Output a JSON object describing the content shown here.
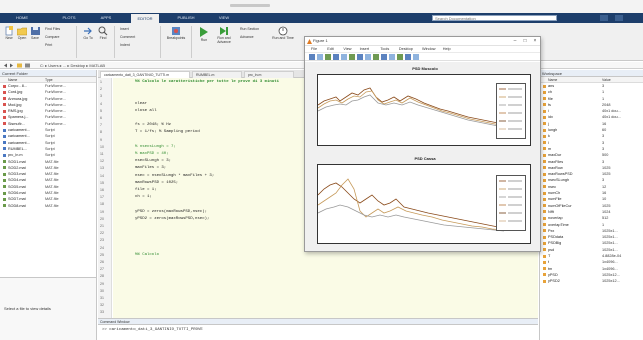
{
  "app": {
    "ribbon_tabs": [
      "HOME",
      "PLOTS",
      "APPS",
      "EDITOR",
      "PUBLISH",
      "VIEW"
    ],
    "active_tab": "EDITOR",
    "search_placeholder": "Search Documentation"
  },
  "ribbon": {
    "new_label": "New",
    "open_label": "Open",
    "save_label": "Save",
    "find_files": "Find Files",
    "compare": "Compare",
    "print": "Print",
    "go_to": "Go To",
    "find": "Find",
    "insert": "Insert",
    "comment": "Comment",
    "indent": "Indent",
    "breakpoints": "Breakpoints",
    "run": "Run",
    "run_and_advance": "Run and Advance",
    "run_section": "Run Section",
    "advance": "Advance",
    "run_and_time": "Run and Time"
  },
  "current_folder": {
    "title": "Current Folder",
    "col_name": "Name",
    "col_type": "Type",
    "files": [
      {
        "name": "Corpo - 8...",
        "type": "FunWorne...",
        "color": "#d9534f"
      },
      {
        "name": "Cord.jpg",
        "type": "FunWorne...",
        "color": "#d9534f"
      },
      {
        "name": "Anmura.jpg",
        "type": "FunWorne...",
        "color": "#d9534f"
      },
      {
        "name": "Mod.jpg",
        "type": "FunWorne...",
        "color": "#d9534f"
      },
      {
        "name": "RMS.jpg",
        "type": "FunWorne...",
        "color": "#d9534f"
      },
      {
        "name": "Spamera.j...",
        "type": "FunWorne...",
        "color": "#d9534f"
      },
      {
        "name": "Sismufir...",
        "type": "FunWorne...",
        "color": "#d9534f"
      },
      {
        "name": "caricament...",
        "type": "Script",
        "color": "#4a78c2"
      },
      {
        "name": "caricament...",
        "type": "Script",
        "color": "#4a78c2"
      },
      {
        "name": "caricament...",
        "type": "Script",
        "color": "#4a78c2"
      },
      {
        "name": "RUMBEL...",
        "type": "Script",
        "color": "#4a78c2"
      },
      {
        "name": "prc_ln.m",
        "type": "Script",
        "color": "#4a78c2"
      },
      {
        "name": "SOD1.mat",
        "type": "MAT-file",
        "color": "#6a9a4a"
      },
      {
        "name": "SOD2.mat",
        "type": "MAT-file",
        "color": "#6a9a4a"
      },
      {
        "name": "SOD3.mat",
        "type": "MAT-file",
        "color": "#6a9a4a"
      },
      {
        "name": "SOD4.mat",
        "type": "MAT-file",
        "color": "#6a9a4a"
      },
      {
        "name": "SOD5.mat",
        "type": "MAT-file",
        "color": "#6a9a4a"
      },
      {
        "name": "SOD6.mat",
        "type": "MAT-file",
        "color": "#6a9a4a"
      },
      {
        "name": "SOD7.mat",
        "type": "MAT-file",
        "color": "#6a9a4a"
      },
      {
        "name": "SOD8.mat",
        "type": "MAT-file",
        "color": "#6a9a4a"
      }
    ],
    "details_text": "Select a file to view details"
  },
  "editor": {
    "tabs": [
      "caricamento_dati_3_GANTINIO_TUTTI.m",
      "RUMBEL.m",
      "prc_ln.m"
    ],
    "line_numbers": [
      "1",
      "2",
      "3",
      "4",
      "5",
      "6",
      "7",
      "8",
      "9",
      "10",
      "11",
      "12",
      "13",
      "14",
      "15",
      "16",
      "17",
      "18",
      "19",
      "20",
      "21",
      "22",
      "23",
      "24",
      "25",
      "26",
      "27",
      "28",
      "29",
      "30",
      "31",
      "32",
      "33"
    ],
    "cell_title": "%% Calcolo le caratteristiche per tutte le prove di 3 minuti",
    "code_lines": [
      {
        "t": "clear",
        "cls": "code",
        "row": 3
      },
      {
        "t": "close all",
        "cls": "code",
        "row": 4
      },
      {
        "t": "fs = 2048;     % Hz",
        "cls": "code",
        "row": 6
      },
      {
        "t": "T = 1/fs;      % Sampling period",
        "cls": "code",
        "row": 7
      },
      {
        "t": "% nsecsLungh = 7;",
        "cls": "cmt",
        "row": 9
      },
      {
        "t": "% maxPSD = 40;",
        "cls": "cmt",
        "row": 10
      },
      {
        "t": "nsecSLungh = 3;",
        "cls": "code",
        "row": 11
      },
      {
        "t": "maxFiles = 3;",
        "cls": "code",
        "row": 12
      },
      {
        "t": "nsec = nsecSLungh * maxFiles + 3;",
        "cls": "code",
        "row": 13
      },
      {
        "t": "maxRowsPSD = 1025;",
        "cls": "code",
        "row": 14
      },
      {
        "t": "file = 1;",
        "cls": "code",
        "row": 15
      },
      {
        "t": "ch = 1;",
        "cls": "code",
        "row": 16
      },
      {
        "t": "yPSD = zeros(maxRowsPSD,nsec);",
        "cls": "code",
        "row": 18
      },
      {
        "t": "yPSD2 = zeros(maxRowsPSD,nsec);",
        "cls": "code",
        "row": 19
      },
      {
        "t": "%% Calcolo",
        "cls": "cmt",
        "row": 24
      }
    ]
  },
  "command_window": {
    "title": "Command Window",
    "prompt": ">> caricamento_dati_3_GANTINIO_TUTTI_PROVE"
  },
  "workspace": {
    "title": "Workspace",
    "col_name": "Name",
    "col_value": "Value",
    "vars": [
      {
        "name": "ans",
        "value": "3"
      },
      {
        "name": "ch",
        "value": "1"
      },
      {
        "name": "file",
        "value": "1"
      },
      {
        "name": "fs",
        "value": "2048"
      },
      {
        "name": "i",
        "value": "40x1 dou..."
      },
      {
        "name": "idx",
        "value": "40x1 dou..."
      },
      {
        "name": "j",
        "value": "16"
      },
      {
        "name": "lungh",
        "value": "60"
      },
      {
        "name": "k",
        "value": "3"
      },
      {
        "name": "l",
        "value": "3"
      },
      {
        "name": "m",
        "value": "3"
      },
      {
        "name": "maxDur",
        "value": "500"
      },
      {
        "name": "maxFiles",
        "value": "3"
      },
      {
        "name": "maxRow",
        "value": "1025"
      },
      {
        "name": "maxRowsPSD",
        "value": "1025"
      },
      {
        "name": "nsecSLungh",
        "value": "3"
      },
      {
        "name": "nsec",
        "value": "12"
      },
      {
        "name": "numCh",
        "value": "16"
      },
      {
        "name": "numFile",
        "value": "10"
      },
      {
        "name": "numOfFileCur",
        "value": "1025"
      },
      {
        "name": "Nfft",
        "value": "1024"
      },
      {
        "name": "noverlap",
        "value": "512"
      },
      {
        "name": "overlapTime",
        "value": "1"
      },
      {
        "name": "Pxx",
        "value": "1025x1..."
      },
      {
        "name": "PSDdata",
        "value": "1025x1..."
      },
      {
        "name": "PSDBig",
        "value": "1025x1..."
      },
      {
        "name": "psd",
        "value": "1025x1..."
      },
      {
        "name": "T",
        "value": "4.8828e-04"
      },
      {
        "name": "t",
        "value": "1x4096..."
      },
      {
        "name": "tm",
        "value": "1x4096..."
      },
      {
        "name": "yPSD",
        "value": "1025x12..."
      },
      {
        "name": "yPSD2",
        "value": "1025x12..."
      }
    ]
  },
  "figure": {
    "title": "Figure 1",
    "menu": [
      "File",
      "Edit",
      "View",
      "Insert",
      "Tools",
      "Desktop",
      "Window",
      "Help"
    ],
    "plot1_title": "PSD Muscolo",
    "plot2_title": "PSD Cassa",
    "legend_count": 6
  }
}
